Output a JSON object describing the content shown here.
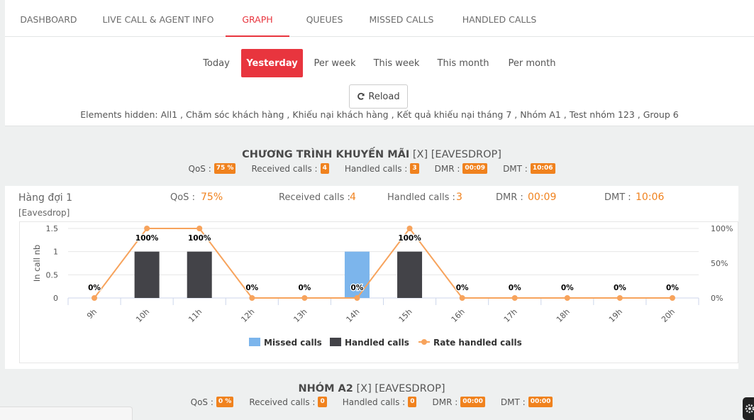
{
  "tabs": [
    {
      "label": "DASHBOARD",
      "active": false
    },
    {
      "label": "LIVE CALL & AGENT INFO",
      "active": false
    },
    {
      "label": "GRAPH",
      "active": true
    },
    {
      "label": "QUEUES",
      "active": false
    },
    {
      "label": "MISSED CALLS",
      "active": false
    },
    {
      "label": "HANDLED CALLS",
      "active": false
    }
  ],
  "periods": [
    "Today",
    "Yesterday",
    "Per week",
    "This week",
    "This month",
    "Per month"
  ],
  "active_period": "Yesterday",
  "reload_label": "Reload",
  "hidden_elements": "Elements hidden: All1 , Chăm sóc khách hàng , Khiếu nại khách hàng , Kết quả khiếu nại tháng 7 , Nhóm A1 , Test nhóm 123 , Group 6",
  "queue1": {
    "name": "CHƯƠNG TRÌNH KHUYẾN MÃI",
    "suffix": "[X] [EAVESDROP]",
    "qos_label": "QoS :",
    "qos": "75 %",
    "received_label": "Received calls :",
    "received": "4",
    "handled_label": "Handled calls :",
    "handled": "3",
    "dmr_label": "DMR :",
    "dmr": "00:09",
    "dmt_label": "DMT :",
    "dmt": "10:06",
    "detail": {
      "name": "Hàng đợi 1",
      "sub": "[Eavesdrop]",
      "qos_label": "QoS :",
      "qos": "75%",
      "received_label": "Received calls :",
      "received": "4",
      "handled_label": "Handled calls :",
      "handled": "3",
      "dmr_label": "DMR :",
      "dmr": "00:09",
      "dmt_label": "DMT :",
      "dmt": "10:06"
    }
  },
  "queue2": {
    "name": "NHÓM A2",
    "suffix": "[X] [EAVESDROP]",
    "qos_label": "QoS :",
    "qos": "0 %",
    "received_label": "Received calls :",
    "received": "0",
    "handled_label": "Handled calls :",
    "handled": "0",
    "dmr_label": "DMR :",
    "dmr": "00:00",
    "dmt_label": "DMT :",
    "dmt": "00:00"
  },
  "colors": {
    "accent": "#e8353e",
    "badge": "#f0821e",
    "missed": "#7cb5ec",
    "handled": "#434348",
    "rate": "#f7a35c"
  },
  "chart_data": {
    "type": "bar",
    "categories": [
      "9h",
      "10h",
      "11h",
      "12h",
      "13h",
      "14h",
      "15h",
      "16h",
      "17h",
      "18h",
      "19h",
      "20h"
    ],
    "series": [
      {
        "name": "Missed calls",
        "type": "bar",
        "values": [
          0,
          0,
          0,
          0,
          0,
          1,
          0,
          0,
          0,
          0,
          0,
          0
        ]
      },
      {
        "name": "Handled calls",
        "type": "bar",
        "values": [
          0,
          1,
          1,
          0,
          0,
          0,
          1,
          0,
          0,
          0,
          0,
          0
        ]
      },
      {
        "name": "Rate handled calls",
        "type": "line",
        "axis": "right",
        "values": [
          0,
          100,
          100,
          0,
          0,
          0,
          100,
          0,
          0,
          0,
          0,
          0
        ]
      }
    ],
    "data_labels": [
      "0%",
      "100%",
      "100%",
      "0%",
      "0%",
      "0%",
      "100%",
      "0%",
      "0%",
      "0%",
      "0%",
      "0%"
    ],
    "ylabel": "In call nb",
    "ylim": [
      0,
      1.5
    ],
    "yticks": [
      "0",
      "0.5",
      "1",
      "1.5"
    ],
    "y2lim": [
      0,
      100
    ],
    "y2ticks": [
      "0%",
      "50%",
      "100%"
    ],
    "grid": true,
    "legend": "bottom"
  }
}
